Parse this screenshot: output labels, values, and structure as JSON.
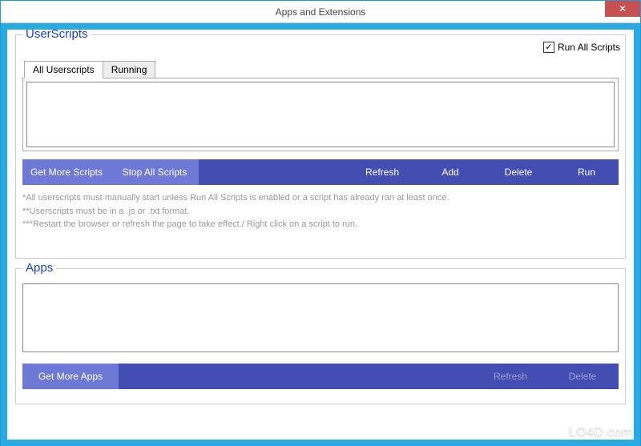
{
  "window": {
    "title": "Apps and Extensions"
  },
  "userscripts": {
    "title": "UserScripts",
    "run_all_label": "Run All Scripts",
    "run_all_checked": true,
    "tabs": {
      "all": "All Userscripts",
      "running": "Running"
    },
    "buttons": {
      "get_more": "Get More Scripts",
      "stop_all": "Stop All Scripts",
      "refresh": "Refresh",
      "add": "Add",
      "delete": "Delete",
      "run": "Run"
    },
    "help1": "*All userscripts must manually start unless Run All Scripts is enabled or a script has already ran at least once.",
    "help2": "**Userscripts must be in a .js or .txt format.",
    "help3": "***Restart the browser or refresh the page to take effect./ Right click on a script to run."
  },
  "apps": {
    "title": "Apps",
    "buttons": {
      "get_more": "Get More Apps",
      "refresh": "Refresh",
      "delete": "Delete"
    }
  },
  "watermark": "LO4D.com"
}
